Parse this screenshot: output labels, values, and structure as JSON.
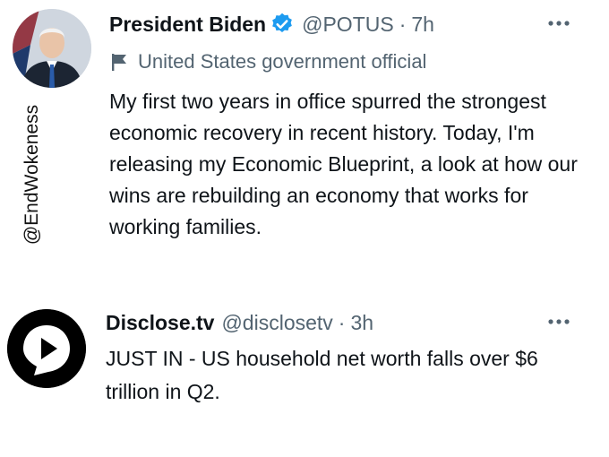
{
  "watermark": "@EndWokeness",
  "tweets": [
    {
      "name": "President Biden",
      "handle": "@POTUS",
      "separator": "·",
      "time": "7h",
      "label": "United States government official",
      "text": "My first two years in office spurred the strongest economic recovery in recent history. Today, I'm releasing my Economic Blueprint, a look at how our wins are rebuilding an economy that works for working families.",
      "verified_color": "#1d9bf0"
    },
    {
      "name": "Disclose.tv",
      "handle": "@disclosetv",
      "separator": "·",
      "time": "3h",
      "text": "JUST IN - US household net worth falls over $6 trillion in Q2."
    }
  ],
  "icons": {
    "verified": "verified-badge-icon",
    "more": "more-options-icon",
    "label": "flag-icon",
    "avatar2": "play-logo-icon"
  }
}
